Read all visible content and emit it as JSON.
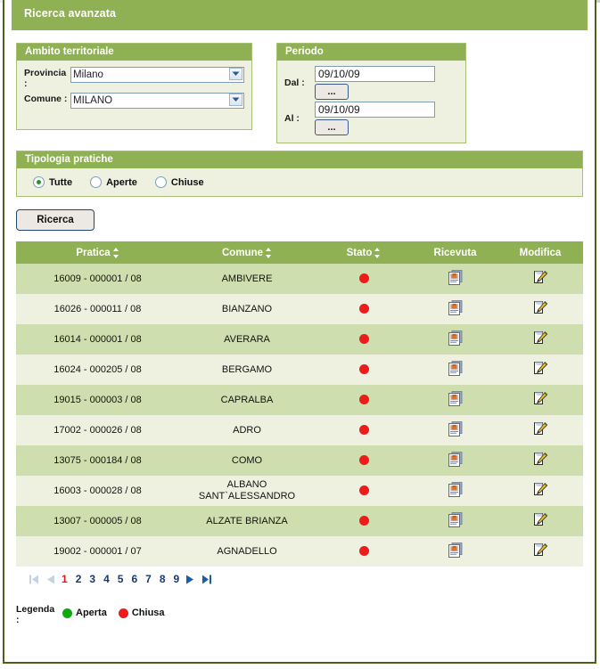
{
  "page": {
    "title": "Ricerca avanzata"
  },
  "panels": {
    "ambito": {
      "legend": "Ambito territoriale",
      "provincia_label": "Provincia :",
      "provincia_value": "Milano",
      "comune_label": "Comune :",
      "comune_value": "MILANO"
    },
    "periodo": {
      "legend": "Periodo",
      "dal_label": "Dal :",
      "dal_value": "09/10/09",
      "dal_button": "...",
      "al_label": "Al :",
      "al_value": "09/10/09",
      "al_button": "..."
    },
    "tipologia": {
      "legend": "Tipologia pratiche",
      "options": [
        {
          "label": "Tutte",
          "checked": true
        },
        {
          "label": "Aperte",
          "checked": false
        },
        {
          "label": "Chiuse",
          "checked": false
        }
      ]
    }
  },
  "actions": {
    "search_label": "Ricerca"
  },
  "table": {
    "columns": [
      {
        "label": "Pratica",
        "sortable": true
      },
      {
        "label": "Comune",
        "sortable": true
      },
      {
        "label": "Stato",
        "sortable": true
      },
      {
        "label": "Ricevuta",
        "sortable": false
      },
      {
        "label": "Modifica",
        "sortable": false
      }
    ],
    "rows": [
      {
        "pratica": "16009 - 000001 / 08",
        "comune": "AMBIVERE",
        "stato": "chiusa",
        "ricevuta_icon": "document-icon",
        "modifica_icon": "edit-icon"
      },
      {
        "pratica": "16026 - 000011 / 08",
        "comune": "BIANZANO",
        "stato": "chiusa",
        "ricevuta_icon": "document-icon",
        "modifica_icon": "edit-icon"
      },
      {
        "pratica": "16014 - 000001 / 08",
        "comune": "AVERARA",
        "stato": "chiusa",
        "ricevuta_icon": "document-icon",
        "modifica_icon": "edit-icon"
      },
      {
        "pratica": "16024 - 000205 / 08",
        "comune": "BERGAMO",
        "stato": "chiusa",
        "ricevuta_icon": "document-icon",
        "modifica_icon": "edit-icon"
      },
      {
        "pratica": "19015 - 000003 / 08",
        "comune": "CAPRALBA",
        "stato": "chiusa",
        "ricevuta_icon": "document-icon",
        "modifica_icon": "edit-icon"
      },
      {
        "pratica": "17002 - 000026 / 08",
        "comune": "ADRO",
        "stato": "chiusa",
        "ricevuta_icon": "document-icon",
        "modifica_icon": "edit-icon"
      },
      {
        "pratica": "13075 - 000184 / 08",
        "comune": "COMO",
        "stato": "chiusa",
        "ricevuta_icon": "document-icon",
        "modifica_icon": "edit-icon"
      },
      {
        "pratica": "16003 - 000028 / 08",
        "comune": "ALBANO SANT`ALESSANDRO",
        "stato": "chiusa",
        "ricevuta_icon": "document-icon",
        "modifica_icon": "edit-icon"
      },
      {
        "pratica": "13007 - 000005 / 08",
        "comune": "ALZATE BRIANZA",
        "stato": "chiusa",
        "ricevuta_icon": "document-icon",
        "modifica_icon": "edit-icon"
      },
      {
        "pratica": "19002 - 000001 / 07",
        "comune": "AGNADELLO",
        "stato": "chiusa",
        "ricevuta_icon": "document-icon",
        "modifica_icon": "edit-icon"
      }
    ]
  },
  "pagination": {
    "first_icon": "first-page-icon",
    "prev_icon": "previous-page-icon",
    "next_icon": "next-page-icon",
    "last_icon": "last-page-icon",
    "current_page": "1",
    "pages": [
      "1",
      "2",
      "3",
      "4",
      "5",
      "6",
      "7",
      "8",
      "9"
    ]
  },
  "legenda": {
    "label": "Legenda :",
    "items": [
      {
        "text": "Aperta",
        "state": "open"
      },
      {
        "text": "Chiusa",
        "state": "closed"
      }
    ]
  },
  "colors": {
    "green_header": "#8fb053",
    "panel_bg": "#eef1e0",
    "row_dark": "#cfdeae",
    "row_light": "#eef1e0",
    "border": "#4e5e1b",
    "status_open": "#13a813",
    "status_closed": "#ee1b1b",
    "current_page": "#e01616",
    "link": "#173a6d"
  }
}
